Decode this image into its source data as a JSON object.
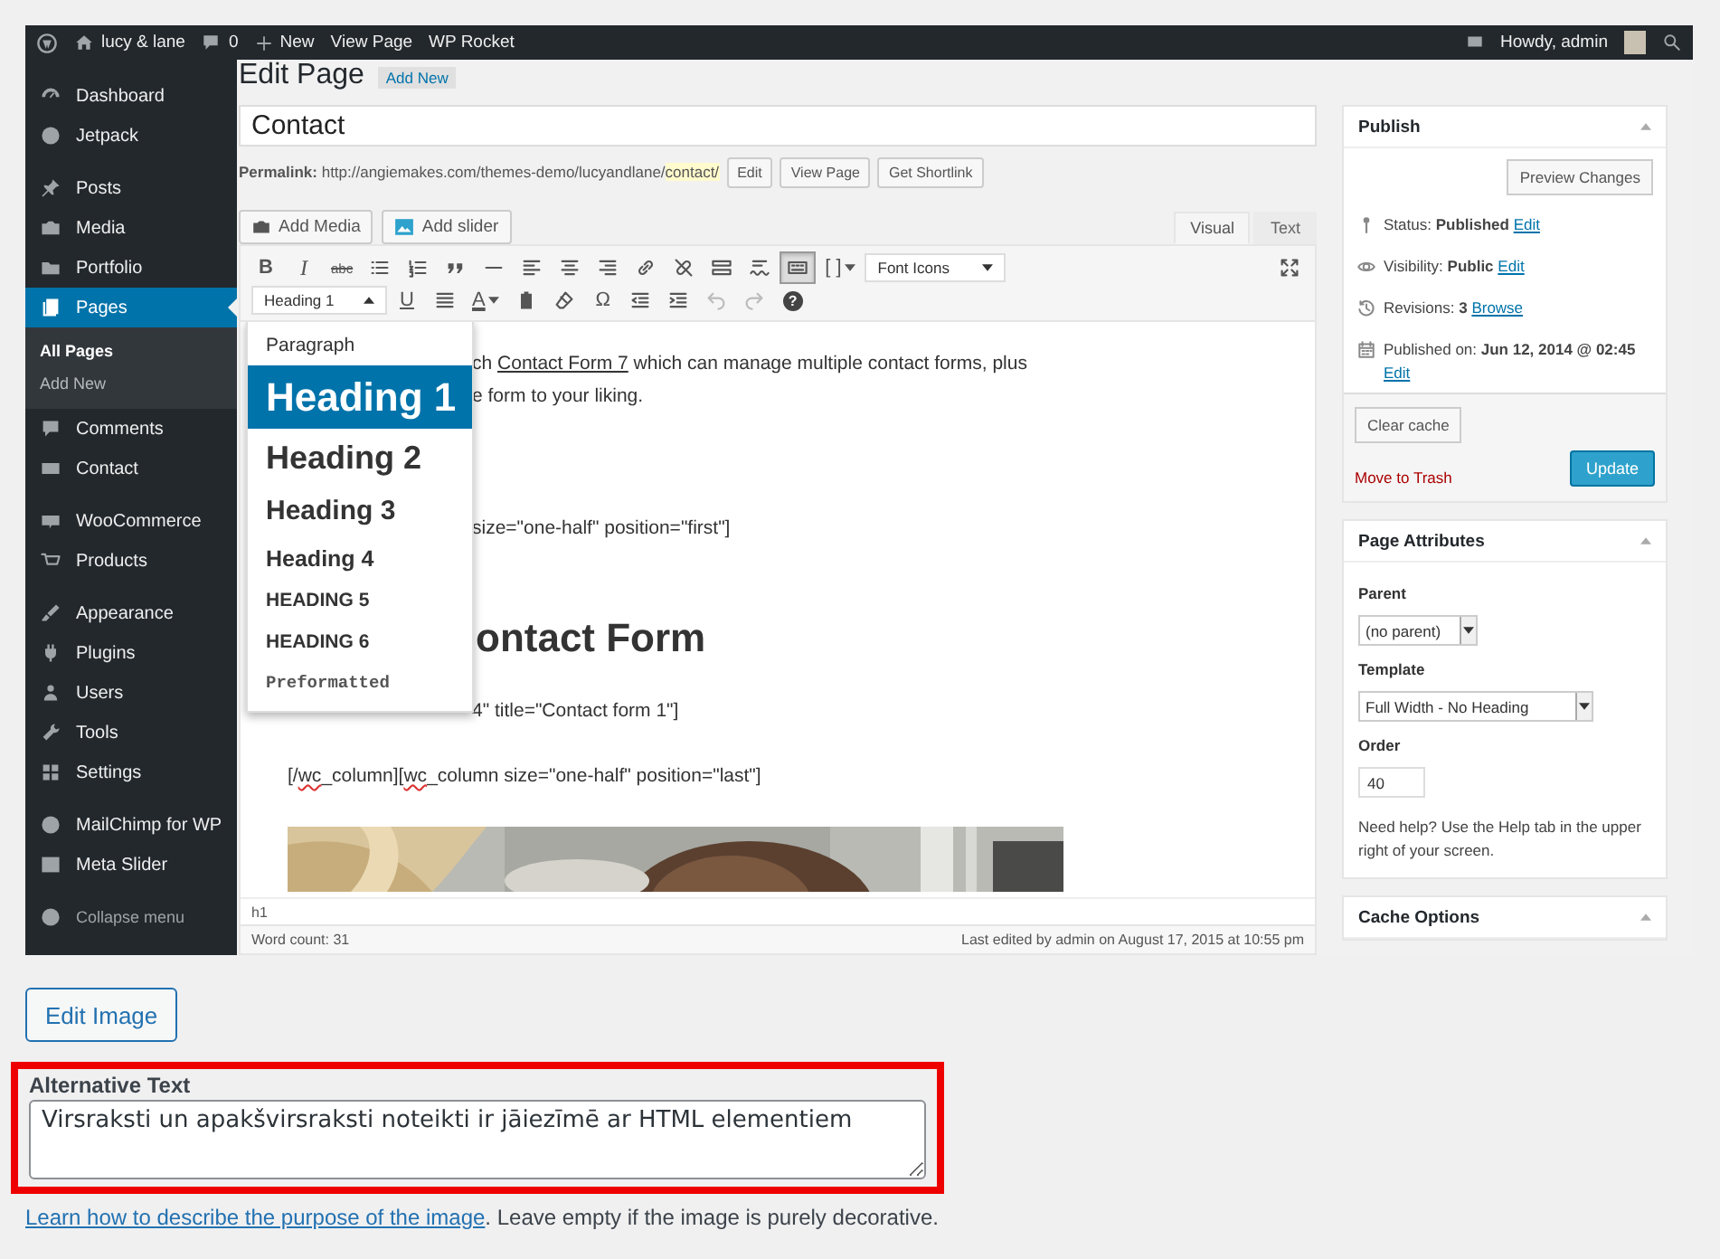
{
  "admin_bar": {
    "site": "lucy & lane",
    "comments": "0",
    "new": "New",
    "links": [
      "View Page",
      "WP Rocket"
    ],
    "greeting": "Howdy, admin"
  },
  "sidebar": {
    "sections": [
      [
        {
          "label": "Dashboard",
          "selected": false
        },
        {
          "label": "Jetpack",
          "selected": false
        }
      ],
      [
        {
          "label": "Posts",
          "selected": false
        },
        {
          "label": "Media",
          "selected": false
        },
        {
          "label": "Portfolio",
          "selected": false
        },
        {
          "label": "Pages",
          "selected": true,
          "children": [
            {
              "label": "All Pages",
              "selected": true
            },
            {
              "label": "Add New",
              "selected": false
            }
          ]
        },
        {
          "label": "Comments",
          "selected": false
        },
        {
          "label": "Contact",
          "selected": false
        }
      ],
      [
        {
          "label": "WooCommerce",
          "selected": false
        },
        {
          "label": "Products",
          "selected": false
        }
      ],
      [
        {
          "label": "Appearance",
          "selected": false
        },
        {
          "label": "Plugins",
          "selected": false
        },
        {
          "label": "Users",
          "selected": false
        },
        {
          "label": "Tools",
          "selected": false
        },
        {
          "label": "Settings",
          "selected": false
        }
      ],
      [
        {
          "label": "MailChimp for WP",
          "selected": false
        },
        {
          "label": "Meta Slider",
          "selected": false
        }
      ]
    ],
    "collapse": "Collapse menu"
  },
  "heading": {
    "title": "Edit Page",
    "add_new": "Add New"
  },
  "post_title": "Contact",
  "permalink": {
    "label": "Permalink:",
    "url": "http://angiemakes.com/themes-demo/lucyandlane/",
    "slug": "contact/",
    "buttons": [
      "Edit",
      "View Page",
      "Get Shortlink"
    ]
  },
  "media_buttons": [
    "Add Media",
    "Add slider"
  ],
  "editor_tabs": [
    {
      "label": "Visual",
      "selected": true
    },
    {
      "label": "Text",
      "selected": false
    }
  ],
  "toolbar": {
    "row1": [
      {
        "kind": "bold",
        "label": "B",
        "on": false
      },
      {
        "kind": "italic",
        "label": "I",
        "on": false
      },
      {
        "kind": "strike",
        "label": "abc",
        "on": false
      },
      {
        "kind": "icon",
        "on": false,
        "disabled": false
      },
      {
        "kind": "icon",
        "on": false,
        "disabled": false
      },
      {
        "kind": "icon",
        "on": false,
        "disabled": false
      },
      {
        "kind": "icon",
        "on": false,
        "disabled": false
      },
      {
        "kind": "icon",
        "on": false,
        "disabled": false
      },
      {
        "kind": "icon",
        "on": false,
        "disabled": false
      },
      {
        "kind": "icon",
        "on": false,
        "disabled": false
      },
      {
        "kind": "icon",
        "on": false,
        "disabled": false
      },
      {
        "kind": "icon",
        "on": false,
        "disabled": false
      },
      {
        "kind": "icon",
        "on": false,
        "disabled": false
      },
      {
        "kind": "icon",
        "on": false,
        "disabled": false
      },
      {
        "kind": "icon",
        "on": true,
        "disabled": false
      },
      {
        "kind": "glyph",
        "label": "[ ]",
        "caret": true,
        "on": false
      },
      {
        "kind": "select",
        "label": "Font Icons",
        "open": false
      },
      {
        "kind": "icon",
        "on": false,
        "disabled": false
      }
    ],
    "row2": [
      {
        "kind": "select",
        "label": "Heading 1",
        "open": true
      },
      {
        "kind": "underline",
        "label": "U",
        "on": false
      },
      {
        "kind": "icon",
        "on": false,
        "disabled": false
      },
      {
        "kind": "color",
        "label": "A",
        "caret": true,
        "on": false
      },
      {
        "kind": "icon",
        "on": false,
        "disabled": false
      },
      {
        "kind": "icon",
        "on": false,
        "disabled": false
      },
      {
        "kind": "glyph",
        "label": "Ω",
        "on": false
      },
      {
        "kind": "icon",
        "on": false,
        "disabled": false
      },
      {
        "kind": "icon",
        "on": false,
        "disabled": false
      },
      {
        "kind": "icon",
        "on": false,
        "disabled": true
      },
      {
        "kind": "icon",
        "on": false,
        "disabled": true
      },
      {
        "kind": "roundglyph",
        "label": "?",
        "on": false
      }
    ]
  },
  "format_menu": [
    {
      "kind": "paragraph",
      "label": "Paragraph",
      "selected": false
    },
    {
      "kind": "h1",
      "label": "Heading 1",
      "selected": true
    },
    {
      "kind": "h2",
      "label": "Heading 2",
      "selected": false
    },
    {
      "kind": "h3",
      "label": "Heading 3",
      "selected": false
    },
    {
      "kind": "h4",
      "label": "Heading 4",
      "selected": false
    },
    {
      "kind": "h5",
      "label": "HEADING 5",
      "selected": false
    },
    {
      "kind": "h6",
      "label": "HEADING 6",
      "selected": false
    },
    {
      "kind": "pre",
      "label": "Preformatted",
      "selected": false
    }
  ],
  "content": [
    {
      "kind": "paragraph",
      "covered": true,
      "parts": [
        {
          "kind": "text",
          "text": "ch "
        },
        {
          "kind": "link",
          "text": "Contact Form 7"
        },
        {
          "kind": "text",
          "text": " which can manage multiple contact forms, plus"
        }
      ]
    },
    {
      "kind": "paragraph",
      "covered": true,
      "parts": [
        {
          "kind": "text",
          "text": "e form to your liking."
        }
      ]
    },
    {
      "kind": "paragraph",
      "covered": true,
      "parts": [
        {
          "kind": "text",
          "text": "size=\"one-half\" position=\"first\"]"
        }
      ]
    },
    {
      "kind": "heading",
      "covered": true,
      "parts": [
        {
          "kind": "text",
          "text": "ontact Form"
        }
      ]
    },
    {
      "kind": "paragraph",
      "covered": true,
      "parts": [
        {
          "kind": "text",
          "text": "4\" title=\"Contact form 1\"]"
        }
      ]
    },
    {
      "kind": "paragraph",
      "parts": [
        {
          "kind": "text",
          "text": "[/"
        },
        {
          "kind": "misspelled",
          "text": "wc"
        },
        {
          "kind": "text",
          "text": "_column]["
        },
        {
          "kind": "misspelled",
          "text": "wc"
        },
        {
          "kind": "text",
          "text": "_column size=\"one-half\" position=\"last\"]"
        }
      ]
    },
    {
      "kind": "picture"
    }
  ],
  "editor_status": {
    "path": "h1",
    "word_count": "Word count: 31",
    "last_edited": "Last edited by admin on August 17, 2015 at 10:55 pm"
  },
  "publish": {
    "title": "Publish",
    "preview": "Preview Changes",
    "rows": [
      {
        "label": "Status: ",
        "value": "Published",
        "link": "Edit"
      },
      {
        "label": "Visibility: ",
        "value": "Public",
        "link": "Edit"
      },
      {
        "label": "Revisions: ",
        "value": "3",
        "link": "Browse"
      },
      {
        "label": "Published on: ",
        "value": "Jun 12, 2014 @ 02:45",
        "link": "Edit"
      }
    ],
    "clear_cache": "Clear cache",
    "trash": "Move to Trash",
    "update": "Update"
  },
  "page_attributes": {
    "title": "Page Attributes",
    "fields": [
      {
        "label": "Parent",
        "kind": "select",
        "value": "(no parent)"
      },
      {
        "label": "Template",
        "kind": "select",
        "value": "Full Width - No Heading"
      },
      {
        "label": "Order",
        "kind": "input",
        "value": "40"
      }
    ],
    "help": "Need help? Use the Help tab in the upper right of your screen."
  },
  "cache_options": {
    "title": "Cache Options"
  },
  "edit_image": "Edit Image",
  "alt_text": {
    "label": "Alternative Text",
    "value": "Virsraksti un apakšvirsraksti noteikti ir jāiezīmē ar HTML elementiem"
  },
  "alt_help": {
    "link": "Learn how to describe the purpose of the image",
    "text": ". Leave empty if the image is purely decorative."
  }
}
